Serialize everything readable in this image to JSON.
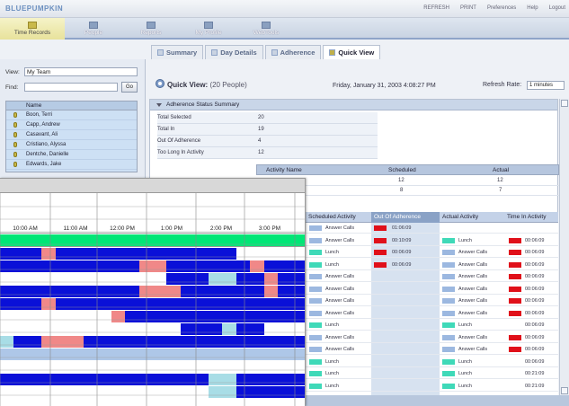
{
  "app": {
    "logo": "BLUEPUMPKIN",
    "toplinks": [
      "REFRESH",
      "PRINT",
      "Preferences",
      "Help",
      "Logout"
    ]
  },
  "navtabs": [
    "Time Records",
    "People",
    "Reports",
    "My Profile",
    "WebTools"
  ],
  "subtabs": [
    "Summary",
    "Day Details",
    "Adherence",
    "Quick View"
  ],
  "left": {
    "view_label": "View:",
    "view_value": "My Team",
    "find_label": "Find:",
    "go_label": "Go",
    "name_header": "Name",
    "names": [
      "Boon, Terri",
      "Capp, Andrew",
      "Casavant, Ali",
      "Cristiano, Alyssa",
      "Dentche, Danielle",
      "Edwards, Jake"
    ]
  },
  "main": {
    "title": "Quick View:",
    "subtitle": "(20 People)",
    "date": "Friday, January 31, 2003 4:08:27 PM",
    "refresh_label": "Refresh Rate:",
    "refresh_value": "1 minutes"
  },
  "summary": {
    "header": "Adherence Status Summary",
    "rows": [
      {
        "label": "Total Selected",
        "value": "20"
      },
      {
        "label": "Total In",
        "value": "19"
      },
      {
        "label": "Out Of Adherence",
        "value": "4"
      },
      {
        "label": "Too Long In Activity",
        "value": "12"
      }
    ],
    "activity_header": {
      "name": "Activity Name",
      "scheduled": "Scheduled",
      "actual": "Actual"
    },
    "activities": [
      {
        "scheduled": "12",
        "actual": "12"
      },
      {
        "scheduled": "8",
        "actual": "7"
      }
    ]
  },
  "table": {
    "headers": [
      "Scheduled Activity",
      "Out Of Adherence",
      "Actual Activity",
      "Time In Activity"
    ],
    "rows": [
      {
        "sched": "Answer Calls",
        "oa": "01:06:09",
        "actual": "",
        "time": "",
        "oa_red": true,
        "time_red": false
      },
      {
        "sched": "Answer Calls",
        "oa": "00:10:09",
        "actual": "Lunch",
        "time": "00:06:09",
        "oa_red": true,
        "time_red": true
      },
      {
        "sched": "Lunch",
        "oa": "00:06:09",
        "actual": "Answer Calls",
        "time": "00:06:09",
        "oa_red": true,
        "time_red": true
      },
      {
        "sched": "Lunch",
        "oa": "00:06:09",
        "actual": "Answer Calls",
        "time": "00:06:09",
        "oa_red": true,
        "time_red": true
      },
      {
        "sched": "Answer Calls",
        "oa": "",
        "actual": "Answer Calls",
        "time": "00:06:09",
        "oa_red": false,
        "time_red": true
      },
      {
        "sched": "Answer Calls",
        "oa": "",
        "actual": "Answer Calls",
        "time": "00:06:09",
        "oa_red": false,
        "time_red": true
      },
      {
        "sched": "Answer Calls",
        "oa": "",
        "actual": "Answer Calls",
        "time": "00:06:09",
        "oa_red": false,
        "time_red": true
      },
      {
        "sched": "Answer Calls",
        "oa": "",
        "actual": "Answer Calls",
        "time": "00:06:09",
        "oa_red": false,
        "time_red": true
      },
      {
        "sched": "Lunch",
        "oa": "",
        "actual": "Lunch",
        "time": "00:06:09",
        "oa_red": false,
        "time_red": false
      },
      {
        "sched": "Answer Calls",
        "oa": "",
        "actual": "Answer Calls",
        "time": "00:06:09",
        "oa_red": false,
        "time_red": true
      },
      {
        "sched": "Answer Calls",
        "oa": "",
        "actual": "Answer Calls",
        "time": "00:06:09",
        "oa_red": false,
        "time_red": true
      },
      {
        "sched": "Lunch",
        "oa": "",
        "actual": "Lunch",
        "time": "00:06:09",
        "oa_red": false,
        "time_red": false
      },
      {
        "sched": "Lunch",
        "oa": "",
        "actual": "Lunch",
        "time": "00:21:09",
        "oa_red": false,
        "time_red": false
      },
      {
        "sched": "Lunch",
        "oa": "",
        "actual": "Lunch",
        "time": "00:21:09",
        "oa_red": false,
        "time_red": false
      },
      {
        "sched": "Lunch",
        "oa": "",
        "actual": "Lunch",
        "time": "00:06:09",
        "oa_red": false,
        "time_red": false
      }
    ]
  },
  "gantt": {
    "times": [
      "10:00 AM",
      "11:00 AM",
      "12:00 PM",
      "1:00 PM",
      "2:00 PM",
      "3:00 PM"
    ],
    "colors": {
      "blue": "#0a10d8",
      "pink": "#f08888",
      "white": "#ffffff",
      "cyan": "#a8dde6",
      "light": "#aec7e8",
      "green": "#00e676"
    },
    "rows": [
      [
        "blue",
        "blue",
        "blue",
        "pink",
        "blue",
        "blue",
        "blue",
        "blue",
        "blue",
        "blue",
        "blue",
        "blue",
        "blue",
        "blue",
        "blue",
        "blue",
        "blue",
        "white",
        "white",
        "white",
        "white",
        "white"
      ],
      [
        "blue",
        "blue",
        "blue",
        "blue",
        "blue",
        "blue",
        "blue",
        "blue",
        "blue",
        "blue",
        "pink",
        "pink",
        "blue",
        "blue",
        "blue",
        "blue",
        "blue",
        "blue",
        "pink",
        "blue",
        "blue",
        "blue"
      ],
      [
        "white",
        "white",
        "white",
        "white",
        "white",
        "white",
        "white",
        "white",
        "white",
        "white",
        "white",
        "white",
        "blue",
        "blue",
        "blue",
        "cyan",
        "cyan",
        "blue",
        "blue",
        "pink",
        "blue",
        "blue"
      ],
      [
        "blue",
        "blue",
        "blue",
        "blue",
        "blue",
        "blue",
        "blue",
        "blue",
        "blue",
        "blue",
        "pink",
        "pink",
        "pink",
        "blue",
        "blue",
        "blue",
        "blue",
        "blue",
        "blue",
        "pink",
        "blue",
        "blue"
      ],
      [
        "blue",
        "blue",
        "blue",
        "pink",
        "blue",
        "blue",
        "blue",
        "blue",
        "blue",
        "blue",
        "blue",
        "blue",
        "blue",
        "blue",
        "blue",
        "blue",
        "blue",
        "blue",
        "blue",
        "blue",
        "blue",
        "blue"
      ],
      [
        "white",
        "white",
        "white",
        "white",
        "white",
        "white",
        "white",
        "white",
        "pink",
        "blue",
        "blue",
        "blue",
        "blue",
        "blue",
        "blue",
        "blue",
        "blue",
        "blue",
        "blue",
        "blue",
        "blue",
        "blue"
      ],
      [
        "white",
        "white",
        "white",
        "white",
        "white",
        "white",
        "white",
        "white",
        "white",
        "white",
        "white",
        "white",
        "white",
        "blue",
        "blue",
        "blue",
        "cyan",
        "blue",
        "blue",
        "white",
        "white",
        "white"
      ],
      [
        "cyan",
        "blue",
        "blue",
        "pink",
        "pink",
        "pink",
        "blue",
        "blue",
        "blue",
        "blue",
        "blue",
        "blue",
        "blue",
        "blue",
        "blue",
        "blue",
        "blue",
        "blue",
        "blue",
        "blue",
        "blue",
        "blue"
      ],
      [
        "light",
        "light",
        "light",
        "light",
        "light",
        "light",
        "light",
        "light",
        "light",
        "light",
        "light",
        "light",
        "light",
        "light",
        "light",
        "light",
        "light",
        "light",
        "light",
        "light",
        "light",
        "light"
      ],
      [
        "white",
        "white",
        "white",
        "white",
        "white",
        "white",
        "white",
        "white",
        "white",
        "white",
        "white",
        "white",
        "white",
        "white",
        "white",
        "white",
        "white",
        "white",
        "white",
        "white",
        "white",
        "white"
      ],
      [
        "blue",
        "blue",
        "blue",
        "blue",
        "blue",
        "blue",
        "blue",
        "blue",
        "blue",
        "blue",
        "blue",
        "blue",
        "blue",
        "blue",
        "blue",
        "cyan",
        "cyan",
        "blue",
        "blue",
        "blue",
        "blue",
        "blue"
      ],
      [
        "white",
        "white",
        "white",
        "white",
        "white",
        "white",
        "white",
        "white",
        "white",
        "white",
        "white",
        "white",
        "white",
        "white",
        "white",
        "cyan",
        "cyan",
        "blue",
        "blue",
        "blue",
        "blue",
        "blue"
      ]
    ]
  }
}
